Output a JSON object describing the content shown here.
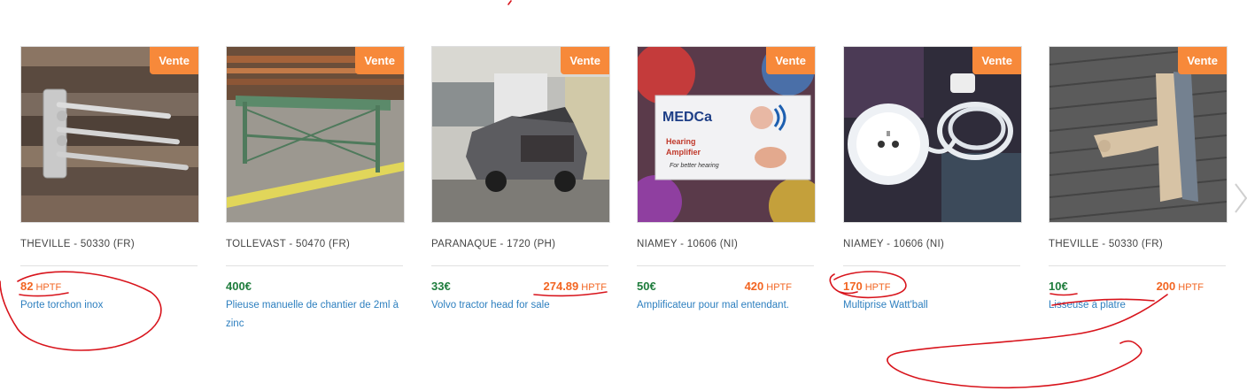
{
  "products": [
    {
      "badge": "Vente",
      "location": "THEVILLE - 50330 (FR)",
      "price_eur": "",
      "price_hptf": "82",
      "hptf_unit": "HPTF",
      "title": "Porte torchon inox"
    },
    {
      "badge": "Vente",
      "location": "TOLLEVAST - 50470 (FR)",
      "price_eur": "400€",
      "price_hptf": "",
      "hptf_unit": "",
      "title": "Plieuse manuelle de chantier de 2ml à zinc"
    },
    {
      "badge": "Vente",
      "location": "PARANAQUE - 1720 (PH)",
      "price_eur": "33€",
      "price_hptf": "274.89",
      "hptf_unit": "HPTF",
      "title": "Volvo tractor head for sale"
    },
    {
      "badge": "Vente",
      "location": "NIAMEY - 10606 (NI)",
      "price_eur": "50€",
      "price_hptf": "420",
      "hptf_unit": "HPTF",
      "title": "Amplificateur pour mal entendant."
    },
    {
      "badge": "Vente",
      "location": "NIAMEY - 10606 (NI)",
      "price_eur": "",
      "price_hptf": "170",
      "hptf_unit": "HPTF",
      "title": "Multiprise Watt'ball"
    },
    {
      "badge": "Vente",
      "location": "THEVILLE - 50330 (FR)",
      "price_eur": "10€",
      "price_hptf": "200",
      "hptf_unit": "HPTF",
      "title": "Lisseuse à platre"
    }
  ],
  "amplifier_box": {
    "brand": "MEDCa",
    "line1": "Hearing",
    "line2": "Amplifier",
    "line3": "For better hearing"
  },
  "colors": {
    "badge": "#f7893a",
    "eur": "#1e7c3c",
    "hptf": "#f26522",
    "link": "#2d7fbf",
    "annotation": "#d8141c"
  },
  "icons": {
    "next": "chevron-right-icon"
  }
}
